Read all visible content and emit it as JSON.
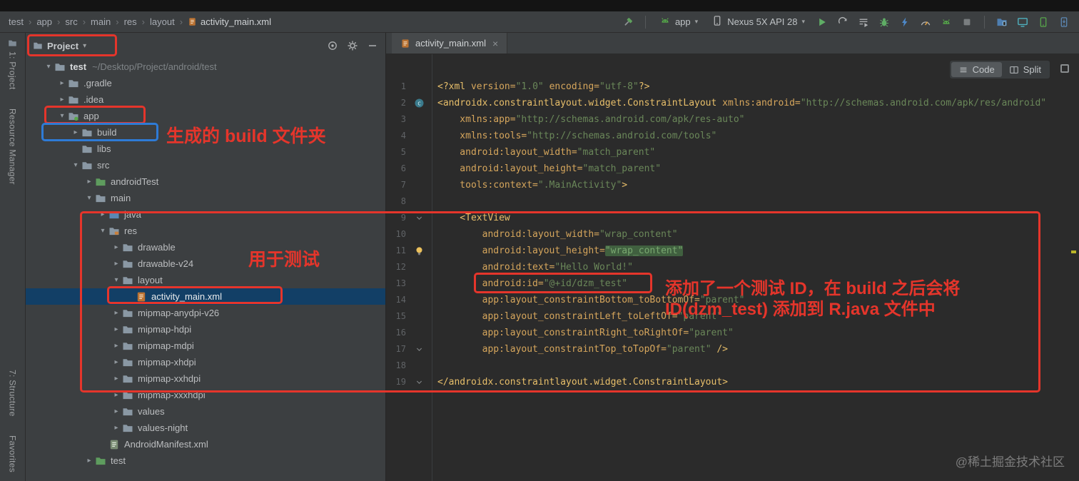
{
  "window": {
    "breadcrumb": [
      "test",
      "app",
      "src",
      "main",
      "res",
      "layout",
      "activity_main.xml"
    ],
    "breadcrumb_separator": "›"
  },
  "toolbar": {
    "run_config_label": "app",
    "device_label": "Nexus 5X API 28",
    "actions": [
      {
        "name": "run-icon",
        "icon": "play"
      },
      {
        "name": "apply-changes-icon",
        "icon": "sync"
      },
      {
        "name": "run-with-coverage-icon",
        "icon": "list-play"
      },
      {
        "name": "debug-icon",
        "icon": "bug"
      },
      {
        "name": "attach-debugger-icon",
        "icon": "bolt"
      },
      {
        "name": "profile-icon",
        "icon": "gauge"
      },
      {
        "name": "apply-code-changes-icon",
        "icon": "android"
      },
      {
        "name": "stop-icon",
        "icon": "stop"
      }
    ],
    "tools": [
      {
        "name": "device-file-explorer-icon",
        "icon": "folder-blue"
      },
      {
        "name": "layout-inspector-icon",
        "icon": "monitor"
      },
      {
        "name": "avd-manager-icon",
        "icon": "phone-green"
      },
      {
        "name": "sdk-manager-icon",
        "icon": "phone-blue"
      }
    ]
  },
  "stripe": {
    "project_label": "1: Project",
    "resource_manager_label": "Resource Manager",
    "structure_label": "7: Structure",
    "favorites_label": "Favorites"
  },
  "project_panel": {
    "title": "Project",
    "header_icons": [
      {
        "name": "locate-file-icon",
        "icon": "target"
      },
      {
        "name": "settings-gear-icon",
        "icon": "gear"
      },
      {
        "name": "hide-panel-icon",
        "icon": "minus"
      }
    ],
    "tree": [
      {
        "label": "test",
        "suffix": "~/Desktop/Project/android/test",
        "level": 0,
        "chev": "open",
        "icon": "folder",
        "bold": true
      },
      {
        "label": ".gradle",
        "level": 1,
        "chev": "closed",
        "icon": "folder"
      },
      {
        "label": ".idea",
        "level": 1,
        "chev": "closed",
        "icon": "folder"
      },
      {
        "label": "app",
        "level": 1,
        "chev": "open",
        "icon": "folder-app"
      },
      {
        "label": "build",
        "level": 2,
        "chev": "closed",
        "icon": "folder"
      },
      {
        "label": "libs",
        "level": 2,
        "chev": "none",
        "icon": "folder"
      },
      {
        "label": "src",
        "level": 2,
        "chev": "open",
        "icon": "folder"
      },
      {
        "label": "androidTest",
        "level": 3,
        "chev": "closed",
        "icon": "folder-test"
      },
      {
        "label": "main",
        "level": 3,
        "chev": "open",
        "icon": "folder"
      },
      {
        "label": "java",
        "level": 4,
        "chev": "closed",
        "icon": "folder-src"
      },
      {
        "label": "res",
        "level": 4,
        "chev": "open",
        "icon": "folder-res"
      },
      {
        "label": "drawable",
        "level": 5,
        "chev": "closed",
        "icon": "folder"
      },
      {
        "label": "drawable-v24",
        "level": 5,
        "chev": "closed",
        "icon": "folder"
      },
      {
        "label": "layout",
        "level": 5,
        "chev": "open",
        "icon": "folder"
      },
      {
        "label": "activity_main.xml",
        "level": 6,
        "chev": "none",
        "icon": "file-xml",
        "selected": true
      },
      {
        "label": "mipmap-anydpi-v26",
        "level": 5,
        "chev": "closed",
        "icon": "folder"
      },
      {
        "label": "mipmap-hdpi",
        "level": 5,
        "chev": "closed",
        "icon": "folder"
      },
      {
        "label": "mipmap-mdpi",
        "level": 5,
        "chev": "closed",
        "icon": "folder"
      },
      {
        "label": "mipmap-xhdpi",
        "level": 5,
        "chev": "closed",
        "icon": "folder"
      },
      {
        "label": "mipmap-xxhdpi",
        "level": 5,
        "chev": "closed",
        "icon": "folder"
      },
      {
        "label": "mipmap-xxxhdpi",
        "level": 5,
        "chev": "closed",
        "icon": "folder"
      },
      {
        "label": "values",
        "level": 5,
        "chev": "closed",
        "icon": "folder"
      },
      {
        "label": "values-night",
        "level": 5,
        "chev": "closed",
        "icon": "folder"
      },
      {
        "label": "AndroidManifest.xml",
        "level": 4,
        "chev": "none",
        "icon": "file-manifest"
      },
      {
        "label": "test",
        "level": 3,
        "chev": "closed",
        "icon": "folder-test"
      }
    ]
  },
  "editor": {
    "tab_label": "activity_main.xml",
    "tab_close": "×",
    "view_toggle": {
      "code": "Code",
      "split": "Split"
    },
    "lines": [
      {
        "n": 1,
        "g": null,
        "s": [
          [
            "tag",
            "<?xml "
          ],
          [
            "attr",
            "version="
          ],
          [
            "str",
            "\"1.0\""
          ],
          [
            "plain",
            " "
          ],
          [
            "attr",
            "encoding="
          ],
          [
            "str",
            "\"utf-8\""
          ],
          [
            "tag",
            "?>"
          ]
        ]
      },
      {
        "n": 2,
        "g": "class",
        "s": [
          [
            "tag",
            "<androidx.constraintlayout.widget.ConstraintLayout "
          ],
          [
            "attr",
            "xmlns:android="
          ],
          [
            "str",
            "\"http://schemas.android.com/apk/res/android\""
          ]
        ]
      },
      {
        "n": 3,
        "g": null,
        "s": [
          [
            "attr",
            "    xmlns:app="
          ],
          [
            "str",
            "\"http://schemas.android.com/apk/res-auto\""
          ]
        ]
      },
      {
        "n": 4,
        "g": null,
        "s": [
          [
            "attr",
            "    xmlns:tools="
          ],
          [
            "str",
            "\"http://schemas.android.com/tools\""
          ]
        ]
      },
      {
        "n": 5,
        "g": null,
        "s": [
          [
            "attr",
            "    android:layout_width="
          ],
          [
            "str",
            "\"match_parent\""
          ]
        ]
      },
      {
        "n": 6,
        "g": null,
        "s": [
          [
            "attr",
            "    android:layout_height="
          ],
          [
            "str",
            "\"match_parent\""
          ]
        ]
      },
      {
        "n": 7,
        "g": null,
        "s": [
          [
            "attr",
            "    tools:context="
          ],
          [
            "str",
            "\".MainActivity\""
          ],
          [
            "tag",
            ">"
          ]
        ]
      },
      {
        "n": 8,
        "g": null,
        "s": []
      },
      {
        "n": 9,
        "g": "fold",
        "s": [
          [
            "tag",
            "    <TextView"
          ]
        ]
      },
      {
        "n": 10,
        "g": null,
        "s": [
          [
            "attr",
            "        android:layout_width="
          ],
          [
            "str",
            "\"wrap_content\""
          ]
        ]
      },
      {
        "n": 11,
        "g": "bulb",
        "s": [
          [
            "attr",
            "        android:layout_height="
          ],
          [
            "strhl",
            "\"wrap_content\""
          ]
        ]
      },
      {
        "n": 12,
        "g": null,
        "s": [
          [
            "attr",
            "        android:text="
          ],
          [
            "str",
            "\"Hello World!\""
          ]
        ]
      },
      {
        "n": 13,
        "g": null,
        "s": [
          [
            "attr",
            "        android:id="
          ],
          [
            "str",
            "\"@+id/dzm_test\""
          ]
        ]
      },
      {
        "n": 14,
        "g": null,
        "s": [
          [
            "attr",
            "        app:layout_constraintBottom_toBottomOf="
          ],
          [
            "str",
            "\"parent\""
          ]
        ]
      },
      {
        "n": 15,
        "g": null,
        "s": [
          [
            "attr",
            "        app:layout_constraintLeft_toLeftOf="
          ],
          [
            "str",
            "\"parent\""
          ]
        ]
      },
      {
        "n": 16,
        "g": null,
        "s": [
          [
            "attr",
            "        app:layout_constraintRight_toRightOf="
          ],
          [
            "str",
            "\"parent\""
          ]
        ]
      },
      {
        "n": 17,
        "g": "fold",
        "s": [
          [
            "attr",
            "        app:layout_constraintTop_toTopOf="
          ],
          [
            "str",
            "\"parent\""
          ],
          [
            "tag",
            " />"
          ]
        ]
      },
      {
        "n": 18,
        "g": null,
        "s": []
      },
      {
        "n": 19,
        "g": "fold",
        "s": [
          [
            "tag",
            "</androidx.constraintlayout.widget.ConstraintLayout>"
          ]
        ]
      }
    ]
  },
  "annotations": {
    "red": "#E5352B",
    "blue": "#2E7BD6",
    "build_note": "生成的 build 文件夹",
    "res_note": "用于测试",
    "id_note_line1": "添加了一个测试 ID，在 build 之后会将",
    "id_note_line2": "ID(dzm_test) 添加到 R.java 文件中"
  },
  "watermark": "@稀土掘金技术社区"
}
